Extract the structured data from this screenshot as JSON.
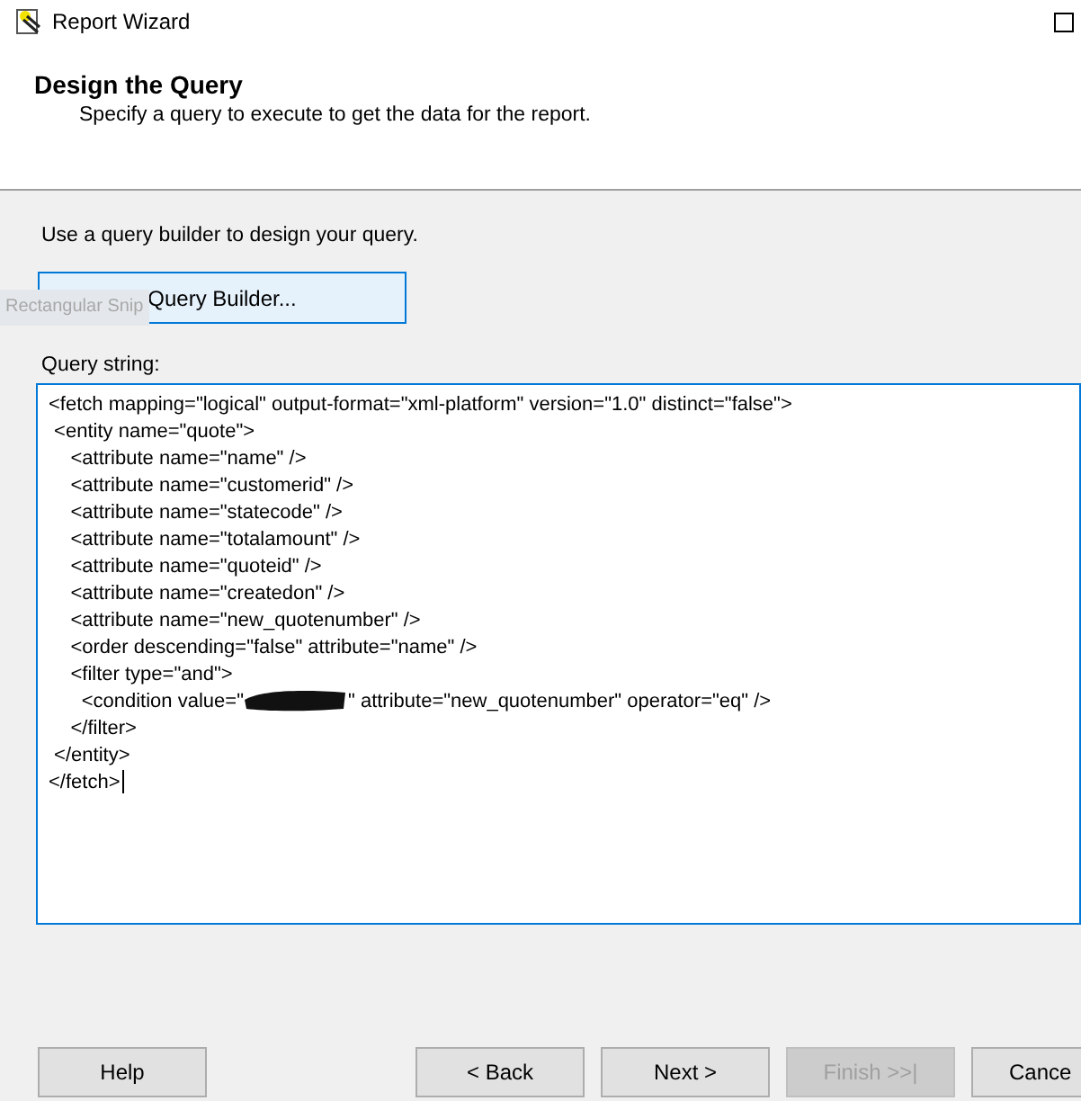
{
  "window": {
    "title": "Report Wizard"
  },
  "header": {
    "title": "Design the Query",
    "subtitle": "Specify a query to execute to get the data for the report."
  },
  "instruction": "Use a query builder to design your query.",
  "query_builder_button": {
    "label": "Query Builder...",
    "focused": true
  },
  "overlay_tooltip": "Rectangular Snip",
  "query_string": {
    "label": "Query string:",
    "caret": true,
    "lines": [
      {
        "text": "<fetch mapping=\"logical\" output-format=\"xml-platform\" version=\"1.0\" distinct=\"false\">"
      },
      {
        "text": " <entity name=\"quote\">"
      },
      {
        "text": "    <attribute name=\"name\" />"
      },
      {
        "text": "    <attribute name=\"customerid\" />"
      },
      {
        "text": "    <attribute name=\"statecode\" />"
      },
      {
        "text": "    <attribute name=\"totalamount\" />"
      },
      {
        "text": "    <attribute name=\"quoteid\" />"
      },
      {
        "text": "    <attribute name=\"createdon\" />"
      },
      {
        "text": "    <attribute name=\"new_quotenumber\" />"
      },
      {
        "text": "    <order descending=\"false\" attribute=\"name\" />"
      },
      {
        "text": "    <filter type=\"and\">"
      },
      {
        "text": "      <condition value=\"",
        "redacted": true,
        "after": "\" attribute=\"new_quotenumber\" operator=\"eq\" />"
      },
      {
        "text": "    </filter>"
      },
      {
        "text": " </entity>"
      },
      {
        "text": "</fetch>"
      }
    ]
  },
  "buttons": [
    {
      "label": "Help",
      "disabled": false
    },
    {
      "label": "< Back",
      "disabled": false
    },
    {
      "label": "Next >",
      "disabled": false
    },
    {
      "label": "Finish >>|",
      "disabled": true
    },
    {
      "label": "Cance",
      "disabled": false
    }
  ]
}
